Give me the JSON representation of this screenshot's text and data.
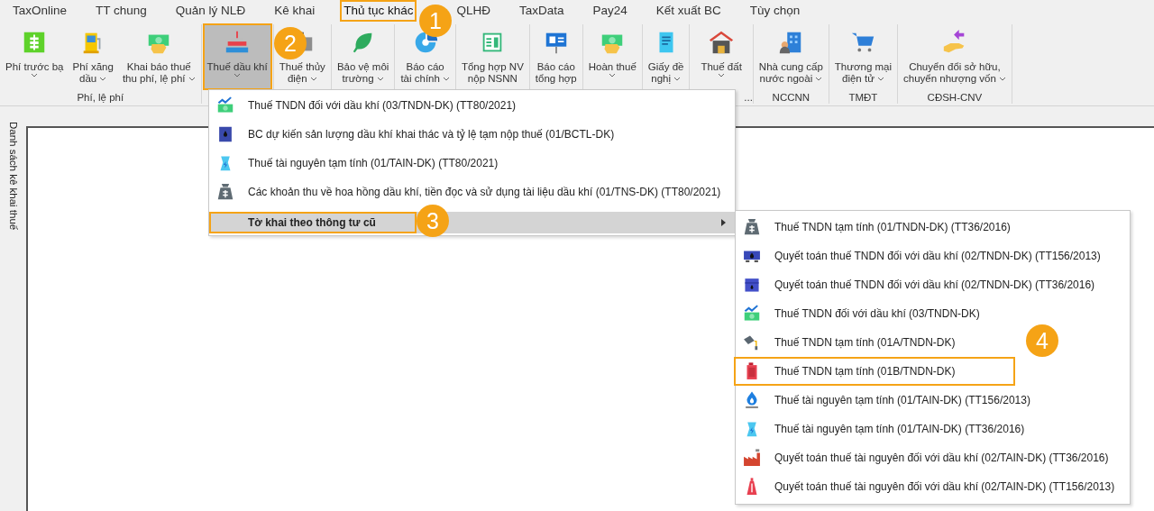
{
  "tabs": [
    {
      "label": "TaxOnline",
      "selected": false
    },
    {
      "label": "TT chung",
      "selected": false
    },
    {
      "label": "Quản lý NLĐ",
      "selected": false
    },
    {
      "label": "Kê khai",
      "selected": false
    },
    {
      "label": "Thủ tục khác",
      "selected": true
    },
    {
      "label": "QLHĐ",
      "selected": false
    },
    {
      "label": "TaxData",
      "selected": false
    },
    {
      "label": "Pay24",
      "selected": false
    },
    {
      "label": "Kết xuất BC",
      "selected": false
    },
    {
      "label": "Tùy chọn",
      "selected": false
    }
  ],
  "ribbon": {
    "groups": [
      {
        "label": "Phí, lệ phí",
        "buttons": [
          {
            "lines": [
              "Phí trước bạ"
            ],
            "dropdown": true,
            "pressed": false
          },
          {
            "lines": [
              "Phí xăng",
              "dầu"
            ],
            "dropdown": true,
            "pressed": false
          },
          {
            "lines": [
              "Khai báo thuế",
              "thu phí, lệ phí"
            ],
            "dropdown": true,
            "pressed": false
          }
        ]
      },
      {
        "buttons": [
          {
            "lines": [
              "Thuế dầu khí"
            ],
            "dropdown": true,
            "pressed": true
          }
        ]
      },
      {
        "buttons": [
          {
            "lines": [
              "Thuế thủy",
              "điện"
            ],
            "dropdown": true,
            "pressed": false
          }
        ]
      },
      {
        "buttons": [
          {
            "lines": [
              "Bảo vệ môi",
              "trường"
            ],
            "dropdown": true,
            "pressed": false
          }
        ]
      },
      {
        "buttons": [
          {
            "lines": [
              "Báo cáo",
              "tài chính"
            ],
            "dropdown": true,
            "pressed": false
          }
        ]
      },
      {
        "buttons": [
          {
            "lines": [
              "Tổng hợp NV",
              "nộp NSNN"
            ],
            "dropdown": false,
            "pressed": false
          }
        ]
      },
      {
        "buttons": [
          {
            "lines": [
              "Báo cáo",
              "tổng hợp"
            ],
            "dropdown": false,
            "pressed": false
          }
        ]
      },
      {
        "buttons": [
          {
            "lines": [
              "Hoàn thuế"
            ],
            "dropdown": true,
            "pressed": false
          }
        ]
      },
      {
        "buttons": [
          {
            "lines": [
              "Giấy đề",
              "nghị"
            ],
            "dropdown": true,
            "pressed": false
          }
        ]
      },
      {
        "label": "...",
        "buttons": [
          {
            "lines": [
              "Thuế đất"
            ],
            "dropdown": true,
            "pressed": false
          }
        ]
      },
      {
        "label": "NCCNN",
        "buttons": [
          {
            "lines": [
              "Nhà cung cấp",
              "nước ngoài"
            ],
            "dropdown": true,
            "pressed": false
          }
        ]
      },
      {
        "label": "TMĐT",
        "buttons": [
          {
            "lines": [
              "Thương mại",
              "điện tử"
            ],
            "dropdown": true,
            "pressed": false
          }
        ]
      },
      {
        "label": "CĐSH-CNV",
        "buttons": [
          {
            "lines": [
              "Chuyển đổi sở hữu,",
              "chuyển nhượng vốn"
            ],
            "dropdown": true,
            "pressed": false
          }
        ]
      }
    ]
  },
  "side_panel": {
    "title": "Danh sách kê khai thuế"
  },
  "menu": {
    "items": [
      {
        "label": "Thuế TNDN đối với dầu khí (03/TNDN-DK) (TT80/2021)",
        "selected": false,
        "highlighted": false,
        "submenu": false
      },
      {
        "label": "BC dự kiến sản lượng dầu khí  khai thác và tỷ lệ tạm nộp thuế (01/BCTL-DK)",
        "selected": false,
        "highlighted": false,
        "submenu": false
      },
      {
        "label": "Thuế tài nguyên tạm tính (01/TAIN-DK) (TT80/2021)",
        "selected": false,
        "highlighted": false,
        "submenu": false
      },
      {
        "label": "Các khoản thu về hoa hồng dầu khí, tiền đọc và sử dụng tài liệu dầu khí (01/TNS-DK) (TT80/2021)",
        "selected": false,
        "highlighted": false,
        "submenu": false
      },
      {
        "label": "Tờ khai theo thông tư cũ",
        "selected": true,
        "highlighted": true,
        "submenu": true
      }
    ]
  },
  "submenu": {
    "items": [
      {
        "label": "Thuế TNDN tạm tính (01/TNDN-DK) (TT36/2016)",
        "highlighted": false
      },
      {
        "label": "Quyết toán thuế TNDN đối với dầu khí (02/TNDN-DK) (TT156/2013)",
        "highlighted": false
      },
      {
        "label": "Quyết toán thuế TNDN đối với dầu khí (02/TNDN-DK) (TT36/2016)",
        "highlighted": false
      },
      {
        "label": "Thuế TNDN đối với dầu khí (03/TNDN-DK)",
        "highlighted": false
      },
      {
        "label": "Thuế TNDN tạm tính (01A/TNDN-DK)",
        "highlighted": false
      },
      {
        "label": "Thuế TNDN tạm tính (01B/TNDN-DK)",
        "highlighted": true
      },
      {
        "label": "Thuế tài nguyên tạm tính (01/TAIN-DK) (TT156/2013)",
        "highlighted": false
      },
      {
        "label": "Thuế tài nguyên tạm tính (01/TAIN-DK) (TT36/2016)",
        "highlighted": false
      },
      {
        "label": "Quyết toán thuế tài nguyên đối với dầu khí (02/TAIN-DK) (TT36/2016)",
        "highlighted": false
      },
      {
        "label": "Quyết toán thuế tài nguyên đối với dầu khí (02/TAIN-DK) (TT156/2013)",
        "highlighted": false
      }
    ]
  },
  "callouts": [
    {
      "number": "1"
    },
    {
      "number": "2"
    },
    {
      "number": "3"
    },
    {
      "number": "4"
    }
  ]
}
